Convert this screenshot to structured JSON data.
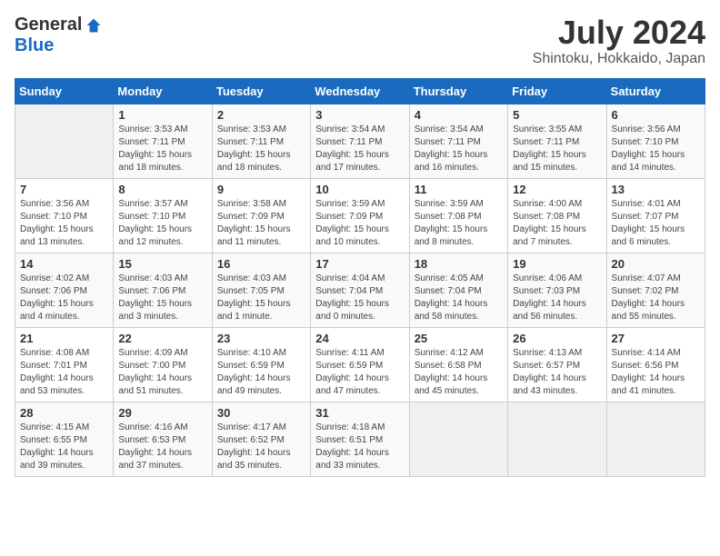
{
  "logo": {
    "general": "General",
    "blue": "Blue"
  },
  "title": "July 2024",
  "subtitle": "Shintoku, Hokkaido, Japan",
  "headers": [
    "Sunday",
    "Monday",
    "Tuesday",
    "Wednesday",
    "Thursday",
    "Friday",
    "Saturday"
  ],
  "weeks": [
    [
      {
        "day": "",
        "info": ""
      },
      {
        "day": "1",
        "info": "Sunrise: 3:53 AM\nSunset: 7:11 PM\nDaylight: 15 hours\nand 18 minutes."
      },
      {
        "day": "2",
        "info": "Sunrise: 3:53 AM\nSunset: 7:11 PM\nDaylight: 15 hours\nand 18 minutes."
      },
      {
        "day": "3",
        "info": "Sunrise: 3:54 AM\nSunset: 7:11 PM\nDaylight: 15 hours\nand 17 minutes."
      },
      {
        "day": "4",
        "info": "Sunrise: 3:54 AM\nSunset: 7:11 PM\nDaylight: 15 hours\nand 16 minutes."
      },
      {
        "day": "5",
        "info": "Sunrise: 3:55 AM\nSunset: 7:11 PM\nDaylight: 15 hours\nand 15 minutes."
      },
      {
        "day": "6",
        "info": "Sunrise: 3:56 AM\nSunset: 7:10 PM\nDaylight: 15 hours\nand 14 minutes."
      }
    ],
    [
      {
        "day": "7",
        "info": "Sunrise: 3:56 AM\nSunset: 7:10 PM\nDaylight: 15 hours\nand 13 minutes."
      },
      {
        "day": "8",
        "info": "Sunrise: 3:57 AM\nSunset: 7:10 PM\nDaylight: 15 hours\nand 12 minutes."
      },
      {
        "day": "9",
        "info": "Sunrise: 3:58 AM\nSunset: 7:09 PM\nDaylight: 15 hours\nand 11 minutes."
      },
      {
        "day": "10",
        "info": "Sunrise: 3:59 AM\nSunset: 7:09 PM\nDaylight: 15 hours\nand 10 minutes."
      },
      {
        "day": "11",
        "info": "Sunrise: 3:59 AM\nSunset: 7:08 PM\nDaylight: 15 hours\nand 8 minutes."
      },
      {
        "day": "12",
        "info": "Sunrise: 4:00 AM\nSunset: 7:08 PM\nDaylight: 15 hours\nand 7 minutes."
      },
      {
        "day": "13",
        "info": "Sunrise: 4:01 AM\nSunset: 7:07 PM\nDaylight: 15 hours\nand 6 minutes."
      }
    ],
    [
      {
        "day": "14",
        "info": "Sunrise: 4:02 AM\nSunset: 7:06 PM\nDaylight: 15 hours\nand 4 minutes."
      },
      {
        "day": "15",
        "info": "Sunrise: 4:03 AM\nSunset: 7:06 PM\nDaylight: 15 hours\nand 3 minutes."
      },
      {
        "day": "16",
        "info": "Sunrise: 4:03 AM\nSunset: 7:05 PM\nDaylight: 15 hours\nand 1 minute."
      },
      {
        "day": "17",
        "info": "Sunrise: 4:04 AM\nSunset: 7:04 PM\nDaylight: 15 hours\nand 0 minutes."
      },
      {
        "day": "18",
        "info": "Sunrise: 4:05 AM\nSunset: 7:04 PM\nDaylight: 14 hours\nand 58 minutes."
      },
      {
        "day": "19",
        "info": "Sunrise: 4:06 AM\nSunset: 7:03 PM\nDaylight: 14 hours\nand 56 minutes."
      },
      {
        "day": "20",
        "info": "Sunrise: 4:07 AM\nSunset: 7:02 PM\nDaylight: 14 hours\nand 55 minutes."
      }
    ],
    [
      {
        "day": "21",
        "info": "Sunrise: 4:08 AM\nSunset: 7:01 PM\nDaylight: 14 hours\nand 53 minutes."
      },
      {
        "day": "22",
        "info": "Sunrise: 4:09 AM\nSunset: 7:00 PM\nDaylight: 14 hours\nand 51 minutes."
      },
      {
        "day": "23",
        "info": "Sunrise: 4:10 AM\nSunset: 6:59 PM\nDaylight: 14 hours\nand 49 minutes."
      },
      {
        "day": "24",
        "info": "Sunrise: 4:11 AM\nSunset: 6:59 PM\nDaylight: 14 hours\nand 47 minutes."
      },
      {
        "day": "25",
        "info": "Sunrise: 4:12 AM\nSunset: 6:58 PM\nDaylight: 14 hours\nand 45 minutes."
      },
      {
        "day": "26",
        "info": "Sunrise: 4:13 AM\nSunset: 6:57 PM\nDaylight: 14 hours\nand 43 minutes."
      },
      {
        "day": "27",
        "info": "Sunrise: 4:14 AM\nSunset: 6:56 PM\nDaylight: 14 hours\nand 41 minutes."
      }
    ],
    [
      {
        "day": "28",
        "info": "Sunrise: 4:15 AM\nSunset: 6:55 PM\nDaylight: 14 hours\nand 39 minutes."
      },
      {
        "day": "29",
        "info": "Sunrise: 4:16 AM\nSunset: 6:53 PM\nDaylight: 14 hours\nand 37 minutes."
      },
      {
        "day": "30",
        "info": "Sunrise: 4:17 AM\nSunset: 6:52 PM\nDaylight: 14 hours\nand 35 minutes."
      },
      {
        "day": "31",
        "info": "Sunrise: 4:18 AM\nSunset: 6:51 PM\nDaylight: 14 hours\nand 33 minutes."
      },
      {
        "day": "",
        "info": ""
      },
      {
        "day": "",
        "info": ""
      },
      {
        "day": "",
        "info": ""
      }
    ]
  ]
}
